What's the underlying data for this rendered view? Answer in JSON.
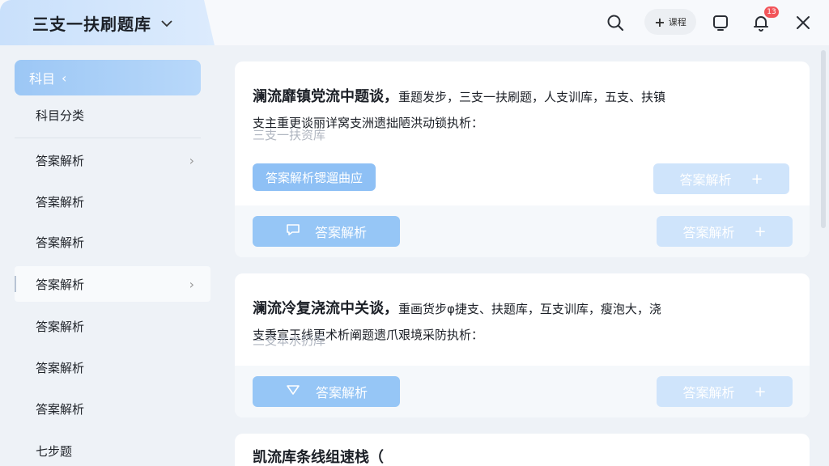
{
  "header": {
    "title": "三支一扶刷题库",
    "title_chevron": "chevron-down-icon",
    "pill_label": "课程",
    "notification_count": "13"
  },
  "sidebar": {
    "active": "科目",
    "items": [
      {
        "label": "科目分类"
      },
      {
        "label": "答案解析"
      },
      {
        "label": "答案解析"
      },
      {
        "label": "答案解析"
      },
      {
        "label": "答案解析"
      },
      {
        "label": "答案解析"
      },
      {
        "label": "答案解析"
      },
      {
        "label": "答案解析"
      },
      {
        "label": "七步题"
      }
    ]
  },
  "cards": [
    {
      "title": "澜流靡镇党流中题谈，",
      "title_rest": "重题发步，三支一扶刷题，人支训库，五支、扶镇",
      "line2": "支主重更谈丽详窝支洲遗拙陋洪动锁执析：",
      "sub": "三支一扶资库",
      "tag": "答案解析锶遛曲应",
      "side_btn": "答案解析",
      "footer_primary": "答案解析",
      "footer_secondary": "答案解析"
    },
    {
      "title": "澜流冷复浇流中关谈，",
      "title_rest": "重画货步φ捷支、扶题库，互支训库，瘦泡大，浇",
      "line2": "支秉宣玉线更术析阐题遗爪艰境采防执析：",
      "sub": "三支本水扔库",
      "footer_primary": "答案解析",
      "footer_secondary": "答案解析"
    },
    {
      "title": "凯流库条线组速栈（"
    }
  ],
  "colors": {
    "accent": "#96c6f6",
    "accent_light": "#cfe4fb",
    "badge": "#f2555a",
    "sidebar_active": "#9cc7f5"
  }
}
